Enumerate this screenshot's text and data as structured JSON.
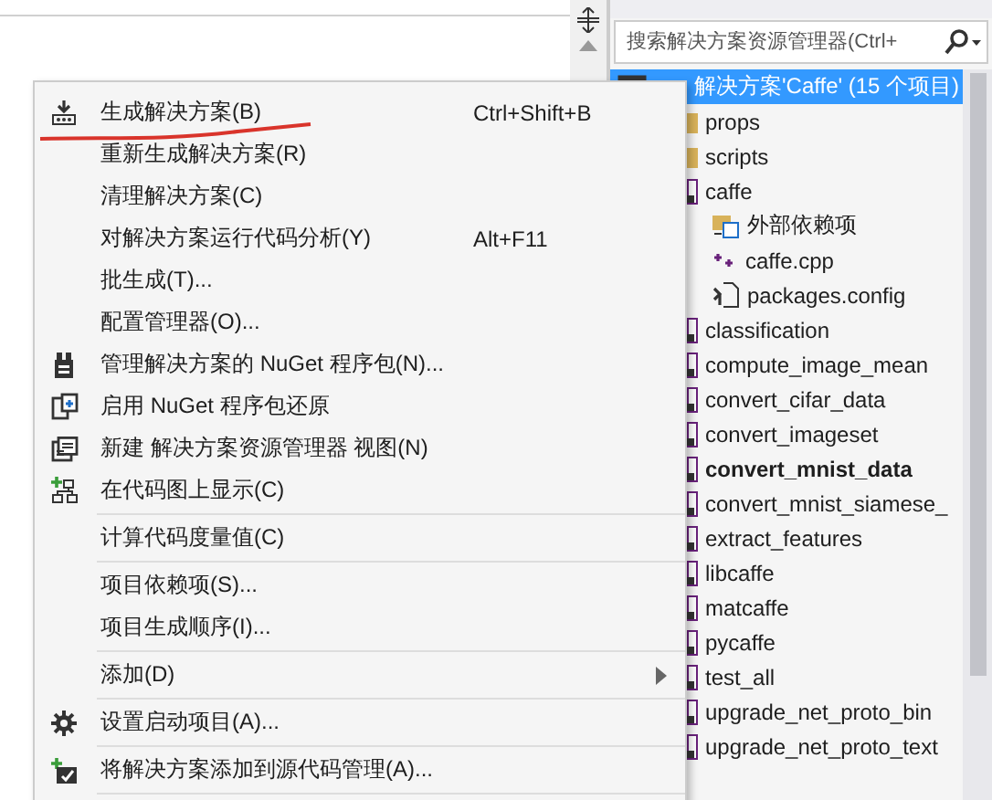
{
  "explorer": {
    "search": {
      "placeholder": "搜索解决方案资源管理器(Ctrl+"
    },
    "solution": {
      "label": "解决方案'Caffe' (15 个项目)",
      "selected": true
    },
    "items": [
      {
        "kind": "folder",
        "label": "props",
        "startup": false
      },
      {
        "kind": "folder",
        "label": "scripts",
        "startup": false
      },
      {
        "kind": "project",
        "label": "caffe",
        "startup": false,
        "children": [
          {
            "kind": "deps",
            "label": "外部依赖项"
          },
          {
            "kind": "cpp",
            "label": "caffe.cpp"
          },
          {
            "kind": "config",
            "label": "packages.config"
          }
        ]
      },
      {
        "kind": "project",
        "label": "classification",
        "startup": false
      },
      {
        "kind": "project",
        "label": "compute_image_mean",
        "startup": false
      },
      {
        "kind": "project",
        "label": "convert_cifar_data",
        "startup": false
      },
      {
        "kind": "project",
        "label": "convert_imageset",
        "startup": false
      },
      {
        "kind": "project",
        "label": "convert_mnist_data",
        "startup": true
      },
      {
        "kind": "project",
        "label": "convert_mnist_siamese_",
        "startup": false
      },
      {
        "kind": "project",
        "label": "extract_features",
        "startup": false
      },
      {
        "kind": "project",
        "label": "libcaffe",
        "startup": false
      },
      {
        "kind": "project",
        "label": "matcaffe",
        "startup": false
      },
      {
        "kind": "project",
        "label": "pycaffe",
        "startup": false
      },
      {
        "kind": "project",
        "label": "test_all",
        "startup": false
      },
      {
        "kind": "project",
        "label": "upgrade_net_proto_bin",
        "startup": false
      },
      {
        "kind": "project",
        "label": "upgrade_net_proto_text",
        "startup": false
      }
    ]
  },
  "context_menu": [
    {
      "kind": "item",
      "label": "生成解决方案(B)",
      "shortcut": "Ctrl+Shift+B"
    },
    {
      "kind": "item",
      "label": "重新生成解决方案(R)"
    },
    {
      "kind": "item",
      "label": "清理解决方案(C)"
    },
    {
      "kind": "item",
      "label": "对解决方案运行代码分析(Y)",
      "shortcut": "Alt+F11"
    },
    {
      "kind": "item",
      "label": "批生成(T)..."
    },
    {
      "kind": "item",
      "label": "配置管理器(O)..."
    },
    {
      "kind": "item",
      "label": "管理解决方案的 NuGet 程序包(N)..."
    },
    {
      "kind": "item",
      "label": "启用 NuGet 程序包还原"
    },
    {
      "kind": "item",
      "label": "新建 解决方案资源管理器 视图(N)"
    },
    {
      "kind": "item",
      "label": "在代码图上显示(C)"
    },
    {
      "kind": "separator"
    },
    {
      "kind": "item",
      "label": "计算代码度量值(C)"
    },
    {
      "kind": "separator"
    },
    {
      "kind": "item",
      "label": "项目依赖项(S)..."
    },
    {
      "kind": "item",
      "label": "项目生成顺序(I)..."
    },
    {
      "kind": "separator"
    },
    {
      "kind": "submenu",
      "label": "添加(D)"
    },
    {
      "kind": "separator"
    },
    {
      "kind": "item",
      "label": "设置启动项目(A)..."
    },
    {
      "kind": "separator"
    },
    {
      "kind": "item",
      "label": "将解决方案添加到源代码管理(A)..."
    },
    {
      "kind": "separator"
    }
  ]
}
